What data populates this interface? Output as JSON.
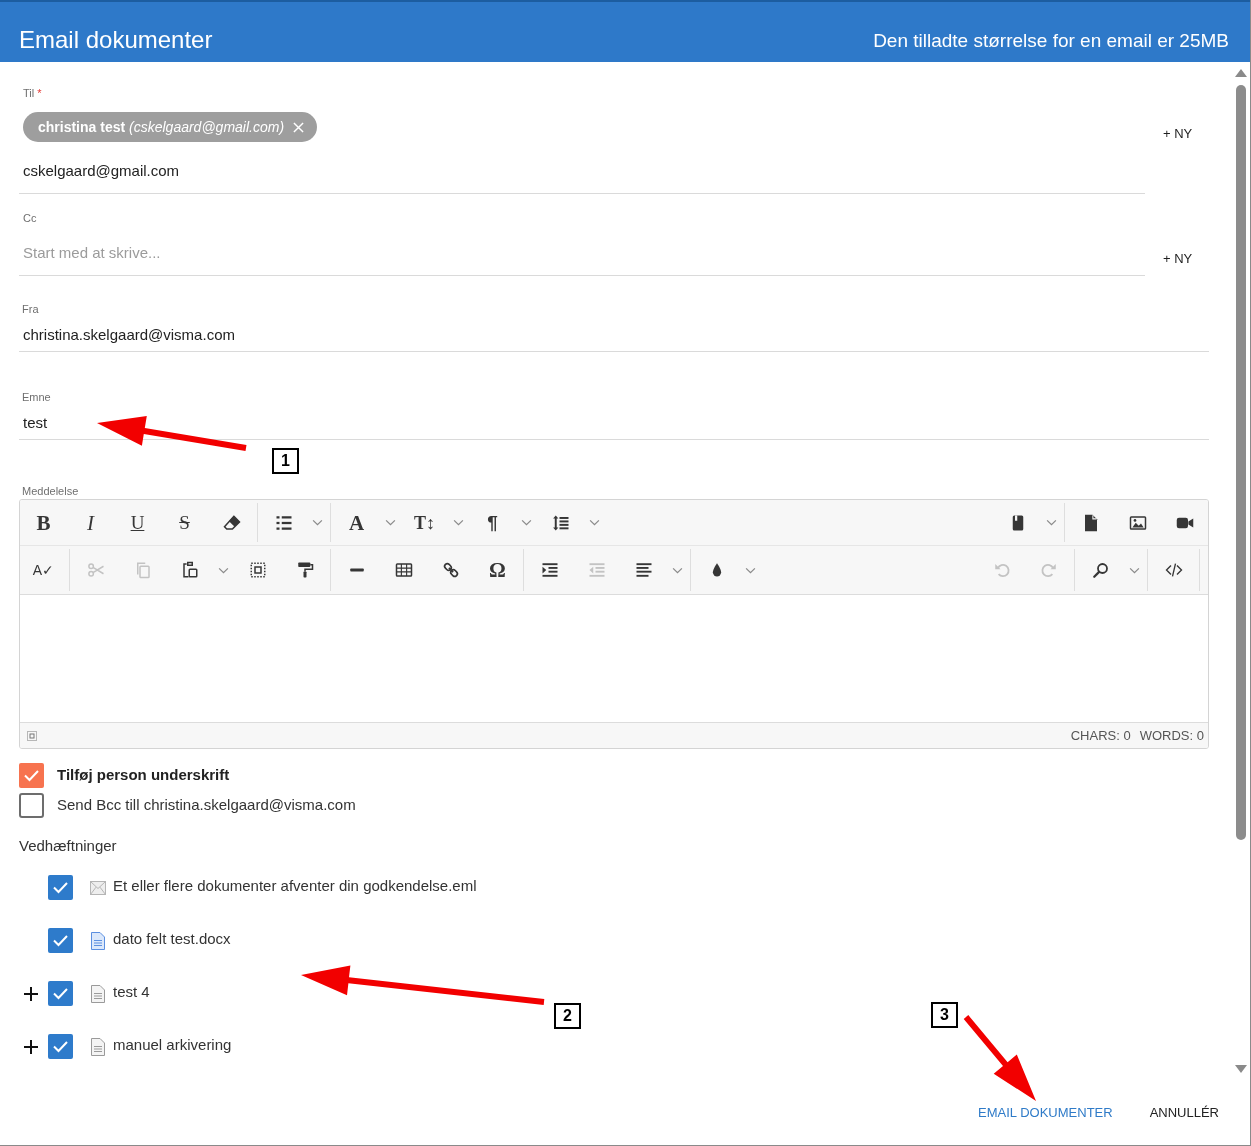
{
  "header": {
    "title": "Email dokumenter",
    "note": "Den tilladte størrelse for en email er 25MB"
  },
  "recipients": [
    {
      "label": "Til",
      "required_mark": "*",
      "chips": [
        "**christina test** *(cskelgaard@gmail.com)*"
      ],
      "value": "cskelgaard@gmail.com",
      "add_button": "+ NY"
    },
    {
      "label": "Cc",
      "placeholder": "Start med at skrive...",
      "add_button": "+ NY"
    }
  ],
  "fields": [
    {
      "label": "Fra",
      "value": "christina.skelgaard@visma.com"
    },
    {
      "label": "Emne",
      "value": "test"
    }
  ],
  "message": {
    "label": "Meddelelse",
    "toolbar": [
      {
        "left": [
          [
            {
              "kind": "bold",
              "glyph": "B",
              "disabled": false
            },
            {
              "kind": "italic",
              "glyph": "I",
              "disabled": false
            },
            {
              "kind": "underline",
              "glyph": "U",
              "disabled": false
            },
            {
              "kind": "strikethrough",
              "glyph": "S",
              "disabled": false
            },
            {
              "kind": "eraser",
              "disabled": false
            }
          ],
          [
            {
              "kind": "numbered-list",
              "disabled": false,
              "dropdown": true
            }
          ],
          [
            {
              "kind": "font",
              "glyph": "A",
              "disabled": false,
              "dropdown": true
            },
            {
              "kind": "font-size",
              "glyph": "T↕",
              "disabled": false,
              "dropdown": true
            },
            {
              "kind": "paragraph",
              "glyph": "¶",
              "disabled": false,
              "dropdown": true
            },
            {
              "kind": "line-spacing",
              "disabled": false,
              "dropdown": true
            }
          ]
        ],
        "right": [
          [
            {
              "kind": "bookmark",
              "disabled": false,
              "dropdown": true
            }
          ],
          [
            {
              "kind": "file",
              "disabled": false
            },
            {
              "kind": "image",
              "disabled": false
            },
            {
              "kind": "video",
              "disabled": false
            }
          ]
        ]
      },
      {
        "left": [
          [
            {
              "kind": "spellcheck",
              "glyph": "A✓",
              "disabled": false
            }
          ],
          [
            {
              "kind": "cut",
              "disabled": true
            },
            {
              "kind": "copy",
              "disabled": true
            },
            {
              "kind": "paste",
              "disabled": false,
              "dropdown": true
            },
            {
              "kind": "select-all",
              "disabled": false
            },
            {
              "kind": "format-painter",
              "disabled": false
            }
          ],
          [
            {
              "kind": "horizontal-line",
              "disabled": false
            },
            {
              "kind": "table",
              "disabled": false
            },
            {
              "kind": "link",
              "disabled": false
            },
            {
              "kind": "special-character",
              "glyph": "Ω",
              "disabled": false
            }
          ],
          [
            {
              "kind": "indent",
              "disabled": false
            },
            {
              "kind": "outdent",
              "disabled": true
            },
            {
              "kind": "align",
              "disabled": false,
              "dropdown": true
            }
          ],
          [
            {
              "kind": "text-color",
              "disabled": false,
              "dropdown": true
            }
          ]
        ],
        "right": [
          [
            {
              "kind": "undo",
              "disabled": true
            },
            {
              "kind": "redo",
              "disabled": true
            }
          ],
          [
            {
              "kind": "search",
              "disabled": false,
              "dropdown": true
            }
          ],
          [
            {
              "kind": "code-view",
              "disabled": false
            }
          ]
        ]
      }
    ],
    "status": [
      "CHARS: 0",
      "WORDS: 0"
    ]
  },
  "options": [
    {
      "label": "Tilføj person underskrift",
      "checked": true,
      "bold": true
    },
    {
      "label": "Send Bcc till christina.skelgaard@visma.com",
      "checked": false,
      "bold": false
    }
  ],
  "attachments": {
    "title": "Vedhæftninger",
    "items": [
      {
        "name": "Et eller flere dokumenter afventer din godkendelse.eml",
        "kind": "eml",
        "checked": true
      },
      {
        "name": "dato felt test.docx",
        "kind": "docx",
        "checked": true
      },
      {
        "name": "test 4",
        "kind": "doc",
        "checked": true,
        "expandable": true
      },
      {
        "name": "manuel arkivering",
        "kind": "doc",
        "checked": true,
        "expandable": true
      }
    ]
  },
  "footer": {
    "buttons": [
      {
        "label": "EMAIL DOKUMENTER",
        "kind": "primary"
      },
      {
        "label": "ANNULLÉR",
        "kind": "secondary"
      }
    ]
  },
  "annotations": [
    {
      "label": "1"
    },
    {
      "label": "2"
    },
    {
      "label": "3"
    }
  ]
}
